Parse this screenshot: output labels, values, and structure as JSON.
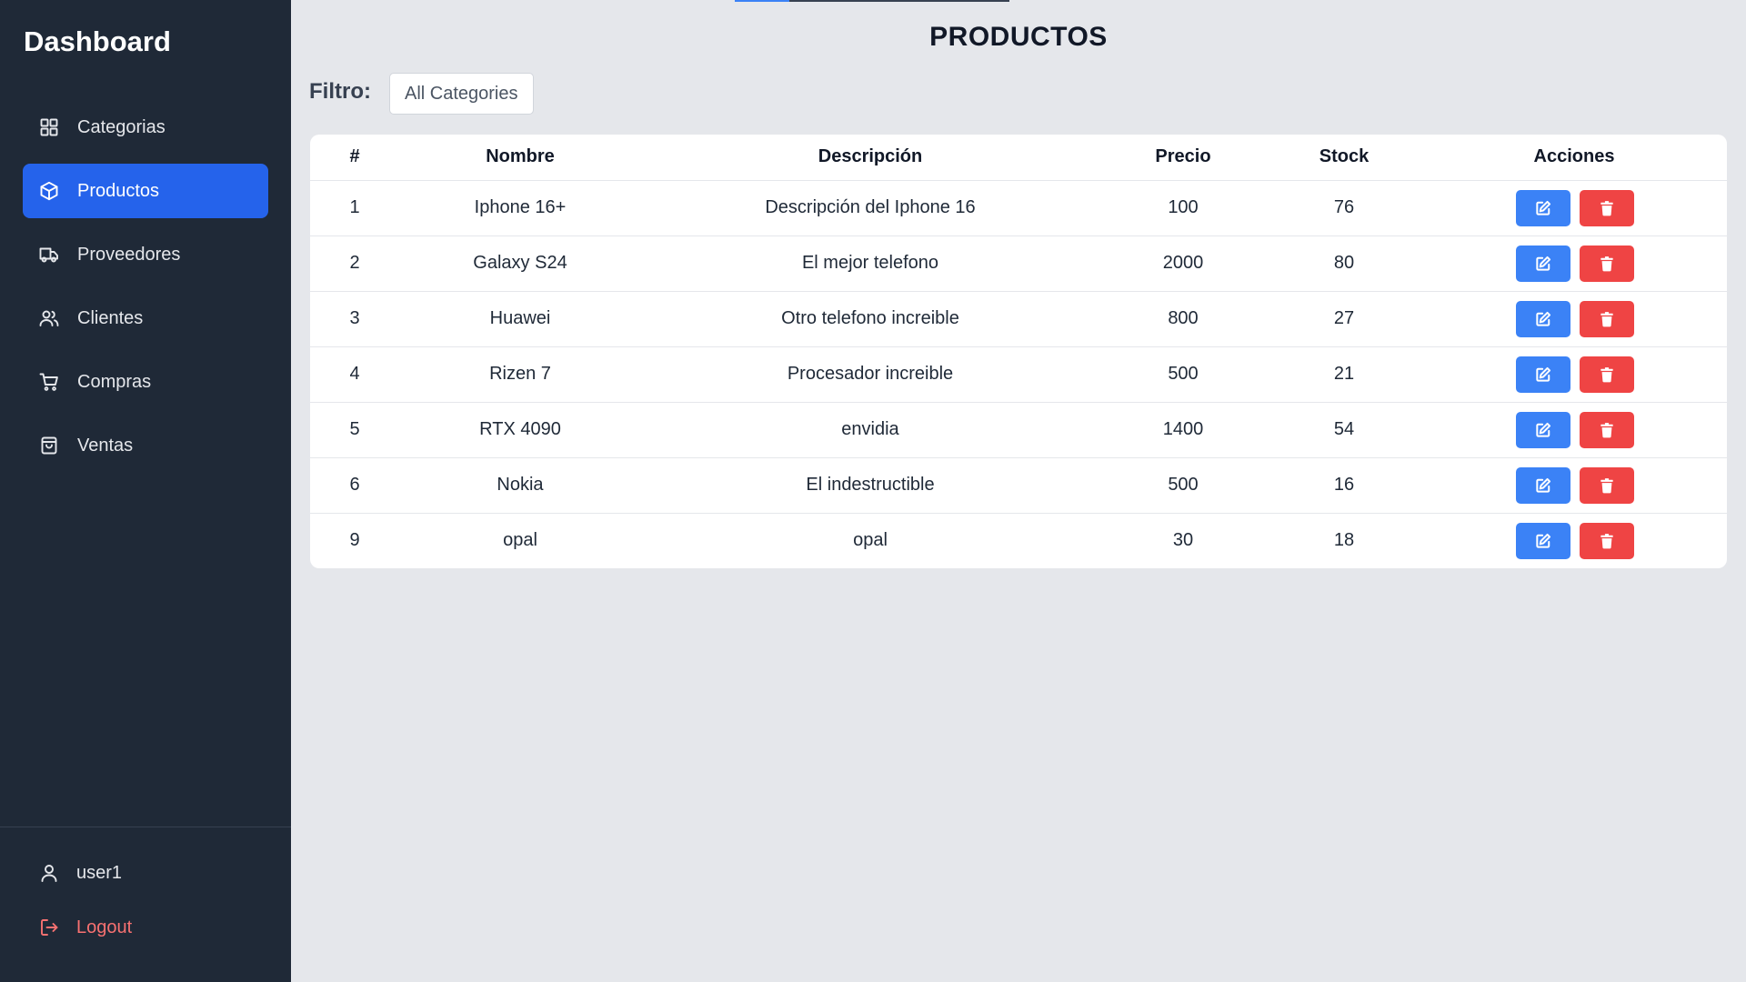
{
  "sidebar": {
    "brand": "Dashboard",
    "items": [
      {
        "label": "Categorias",
        "icon": "grid-icon"
      },
      {
        "label": "Productos",
        "icon": "cube-icon",
        "active": true
      },
      {
        "label": "Proveedores",
        "icon": "truck-icon"
      },
      {
        "label": "Clientes",
        "icon": "users-icon"
      },
      {
        "label": "Compras",
        "icon": "cart-icon"
      },
      {
        "label": "Ventas",
        "icon": "shopping-bag-icon"
      }
    ],
    "user": {
      "label": "user1",
      "icon": "user-icon"
    },
    "logout": {
      "label": "Logout",
      "icon": "logout-icon"
    }
  },
  "main": {
    "title": "PRODUCTOS",
    "filter": {
      "label": "Filtro:",
      "selected": "All Categories"
    },
    "table": {
      "headers": [
        "#",
        "Nombre",
        "Descripción",
        "Precio",
        "Stock",
        "Acciones"
      ],
      "rows": [
        {
          "id": "1",
          "nombre": "Iphone 16+",
          "descripcion": "Descripción del Iphone 16",
          "precio": "100",
          "stock": "76"
        },
        {
          "id": "2",
          "nombre": "Galaxy S24",
          "descripcion": "El mejor telefono",
          "precio": "2000",
          "stock": "80"
        },
        {
          "id": "3",
          "nombre": "Huawei",
          "descripcion": "Otro telefono increible",
          "precio": "800",
          "stock": "27"
        },
        {
          "id": "4",
          "nombre": "Rizen 7",
          "descripcion": "Procesador increible",
          "precio": "500",
          "stock": "21"
        },
        {
          "id": "5",
          "nombre": "RTX 4090",
          "descripcion": "envidia",
          "precio": "1400",
          "stock": "54"
        },
        {
          "id": "6",
          "nombre": "Nokia",
          "descripcion": "El indestructible",
          "precio": "500",
          "stock": "16"
        },
        {
          "id": "9",
          "nombre": "opal",
          "descripcion": "opal",
          "precio": "30",
          "stock": "18"
        }
      ]
    }
  },
  "colors": {
    "sidebar_bg": "#1f2937",
    "active_item": "#2563eb",
    "edit_button": "#3b82f6",
    "delete_button": "#ef4444",
    "logout_text": "#f87171",
    "page_bg": "#e5e7eb"
  }
}
